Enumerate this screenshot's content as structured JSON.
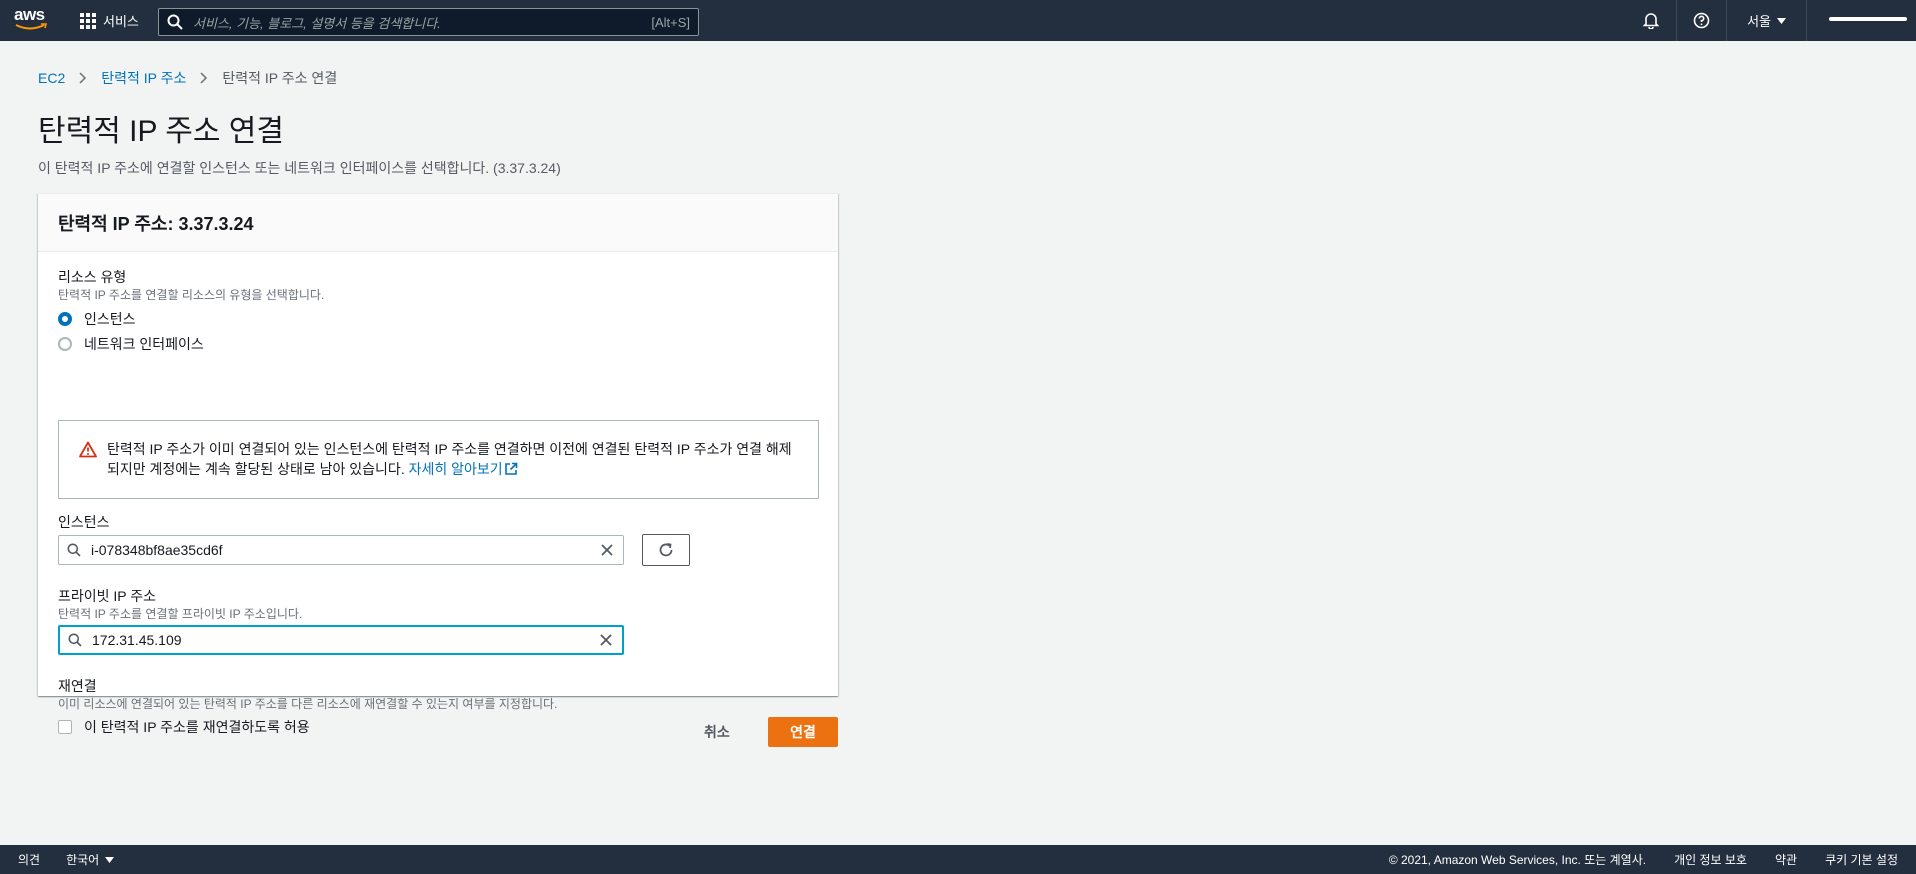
{
  "topnav": {
    "logo_text": "aws",
    "services_label": "서비스",
    "search_placeholder": "서비스, 기능, 블로그, 설명서 등을 검색합니다.",
    "search_shortcut": "[Alt+S]",
    "region_label": "서울"
  },
  "breadcrumb": {
    "items": [
      "EC2",
      "탄력적 IP 주소",
      "탄력적 IP 주소 연결"
    ]
  },
  "page": {
    "title": "탄력적 IP 주소 연결",
    "description": "이 탄력적 IP 주소에 연결할 인스턴스 또는 네트워크 인터페이스를 선택합니다. (3.37.3.24)"
  },
  "panel": {
    "header": "탄력적 IP 주소: 3.37.3.24",
    "resource_type": {
      "label": "리소스 유형",
      "description": "탄력적 IP 주소를 연결할 리소스의 유형을 선택합니다.",
      "options": [
        {
          "label": "인스턴스",
          "selected": true
        },
        {
          "label": "네트워크 인터페이스",
          "selected": false
        }
      ]
    },
    "alert": {
      "text": "탄력적 IP 주소가 이미 연결되어 있는 인스턴스에 탄력적 IP 주소를 연결하면 이전에 연결된 탄력적 IP 주소가 연결 해제되지만 계정에는 계속 할당된 상태로 남아 있습니다.",
      "link": "자세히 알아보기"
    },
    "instance": {
      "label": "인스턴스",
      "value": "i-078348bf8ae35cd6f"
    },
    "private_ip": {
      "label": "프라이빗 IP 주소",
      "description": "탄력적 IP 주소를 연결할 프라이빗 IP 주소입니다.",
      "value": "172.31.45.109"
    },
    "reassociation": {
      "label": "재연결",
      "description": "이미 리소스에 연결되어 있는 탄력적 IP 주소를 다른 리소스에 재연결할 수 있는지 여부를 지정합니다.",
      "checkbox_label": "이 탄력적 IP 주소를 재연결하도록 허용",
      "checked": false
    }
  },
  "actions": {
    "cancel": "취소",
    "connect": "연결"
  },
  "footer": {
    "feedback": "의견",
    "language": "한국어",
    "copyright": "© 2021, Amazon Web Services, Inc. 또는 계열사.",
    "privacy": "개인 정보 보호",
    "terms": "약관",
    "cookies": "쿠키 기본 설정"
  },
  "colors": {
    "nav_bg": "#232f3e",
    "link": "#0073bb",
    "primary_button": "#ec7211",
    "focus_border": "#00a1c9",
    "warning": "#d13212"
  }
}
